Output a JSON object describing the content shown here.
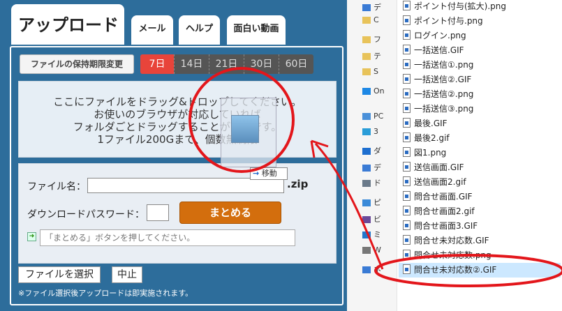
{
  "app": {
    "title": "アップロード",
    "tabs": [
      "メール",
      "ヘルプ",
      "面白い動画"
    ],
    "period_label": "ファイルの保持期限変更",
    "periods": [
      "7日",
      "14日",
      "21日",
      "30日",
      "60日"
    ],
    "active_period": "7日",
    "dropzone_lines": [
      "ここにファイルをドラッグ&ドロップしてください。",
      "お使いのブラウザが対応していれば",
      "フォルダごとドラッグすることが可能です。",
      "1ファイル200Gまで、個数無制限"
    ],
    "filename_label": "ファイル名：",
    "filename_value": "",
    "zip_ext": ".zip",
    "password_label": "ダウンロードパスワード：",
    "password_value": "",
    "bundle_button": "まとめる",
    "status_placeholder": "「まとめる」ボタンを押してください。",
    "select_file_button": "ファイルを選択",
    "stop_button": "中止",
    "note": "※ファイル選択後アップロードは即実施されます。",
    "drag_tooltip": "移動"
  },
  "explorer": {
    "nav_items": [
      {
        "label": "デ",
        "icon": "desktop-icon"
      },
      {
        "label": "C",
        "icon": "folder-icon"
      },
      {
        "label": "フ",
        "icon": "folder-icon"
      },
      {
        "label": "テ",
        "icon": "folder-icon"
      },
      {
        "label": "S",
        "icon": "folder-icon"
      },
      {
        "label": "On",
        "icon": "cloud-icon"
      },
      {
        "label": "PC",
        "icon": "pc-icon"
      },
      {
        "label": "3",
        "icon": "3d-objects-icon"
      },
      {
        "label": "ダ",
        "icon": "download-icon"
      },
      {
        "label": "デ",
        "icon": "desktop-icon"
      },
      {
        "label": "ド",
        "icon": "documents-icon"
      },
      {
        "label": "ピ",
        "icon": "pictures-icon"
      },
      {
        "label": "ビ",
        "icon": "videos-icon"
      },
      {
        "label": "ミ",
        "icon": "music-icon"
      },
      {
        "label": "W",
        "icon": "drive-icon"
      },
      {
        "label": "ネ",
        "icon": "network-icon"
      }
    ],
    "files": [
      "ポイント付与(拡大).png",
      "ポイント付与.png",
      "ログイン.png",
      "一括送信.GIF",
      "一括送信①.png",
      "一括送信②.GIF",
      "一括送信②.png",
      "一括送信③.png",
      "最後.GIF",
      "最後2.gif",
      "図1.png",
      "送信画面.GIF",
      "送信画面2.gif",
      "問合せ画面.GIF",
      "問合せ画面2.gif",
      "問合せ画面3.GIF",
      "問合せ未対応数.GIF",
      "問合せ未対応数.png",
      "問合せ未対応数②.GIF"
    ],
    "selected_file": "問合せ未対応数②.GIF"
  },
  "colors": {
    "app_bg": "#2d6d9b",
    "accent_red": "#e8443a",
    "bundle_orange": "#d36e0d",
    "annotation_red": "#e3161b",
    "selection_blue": "#cce8ff"
  }
}
